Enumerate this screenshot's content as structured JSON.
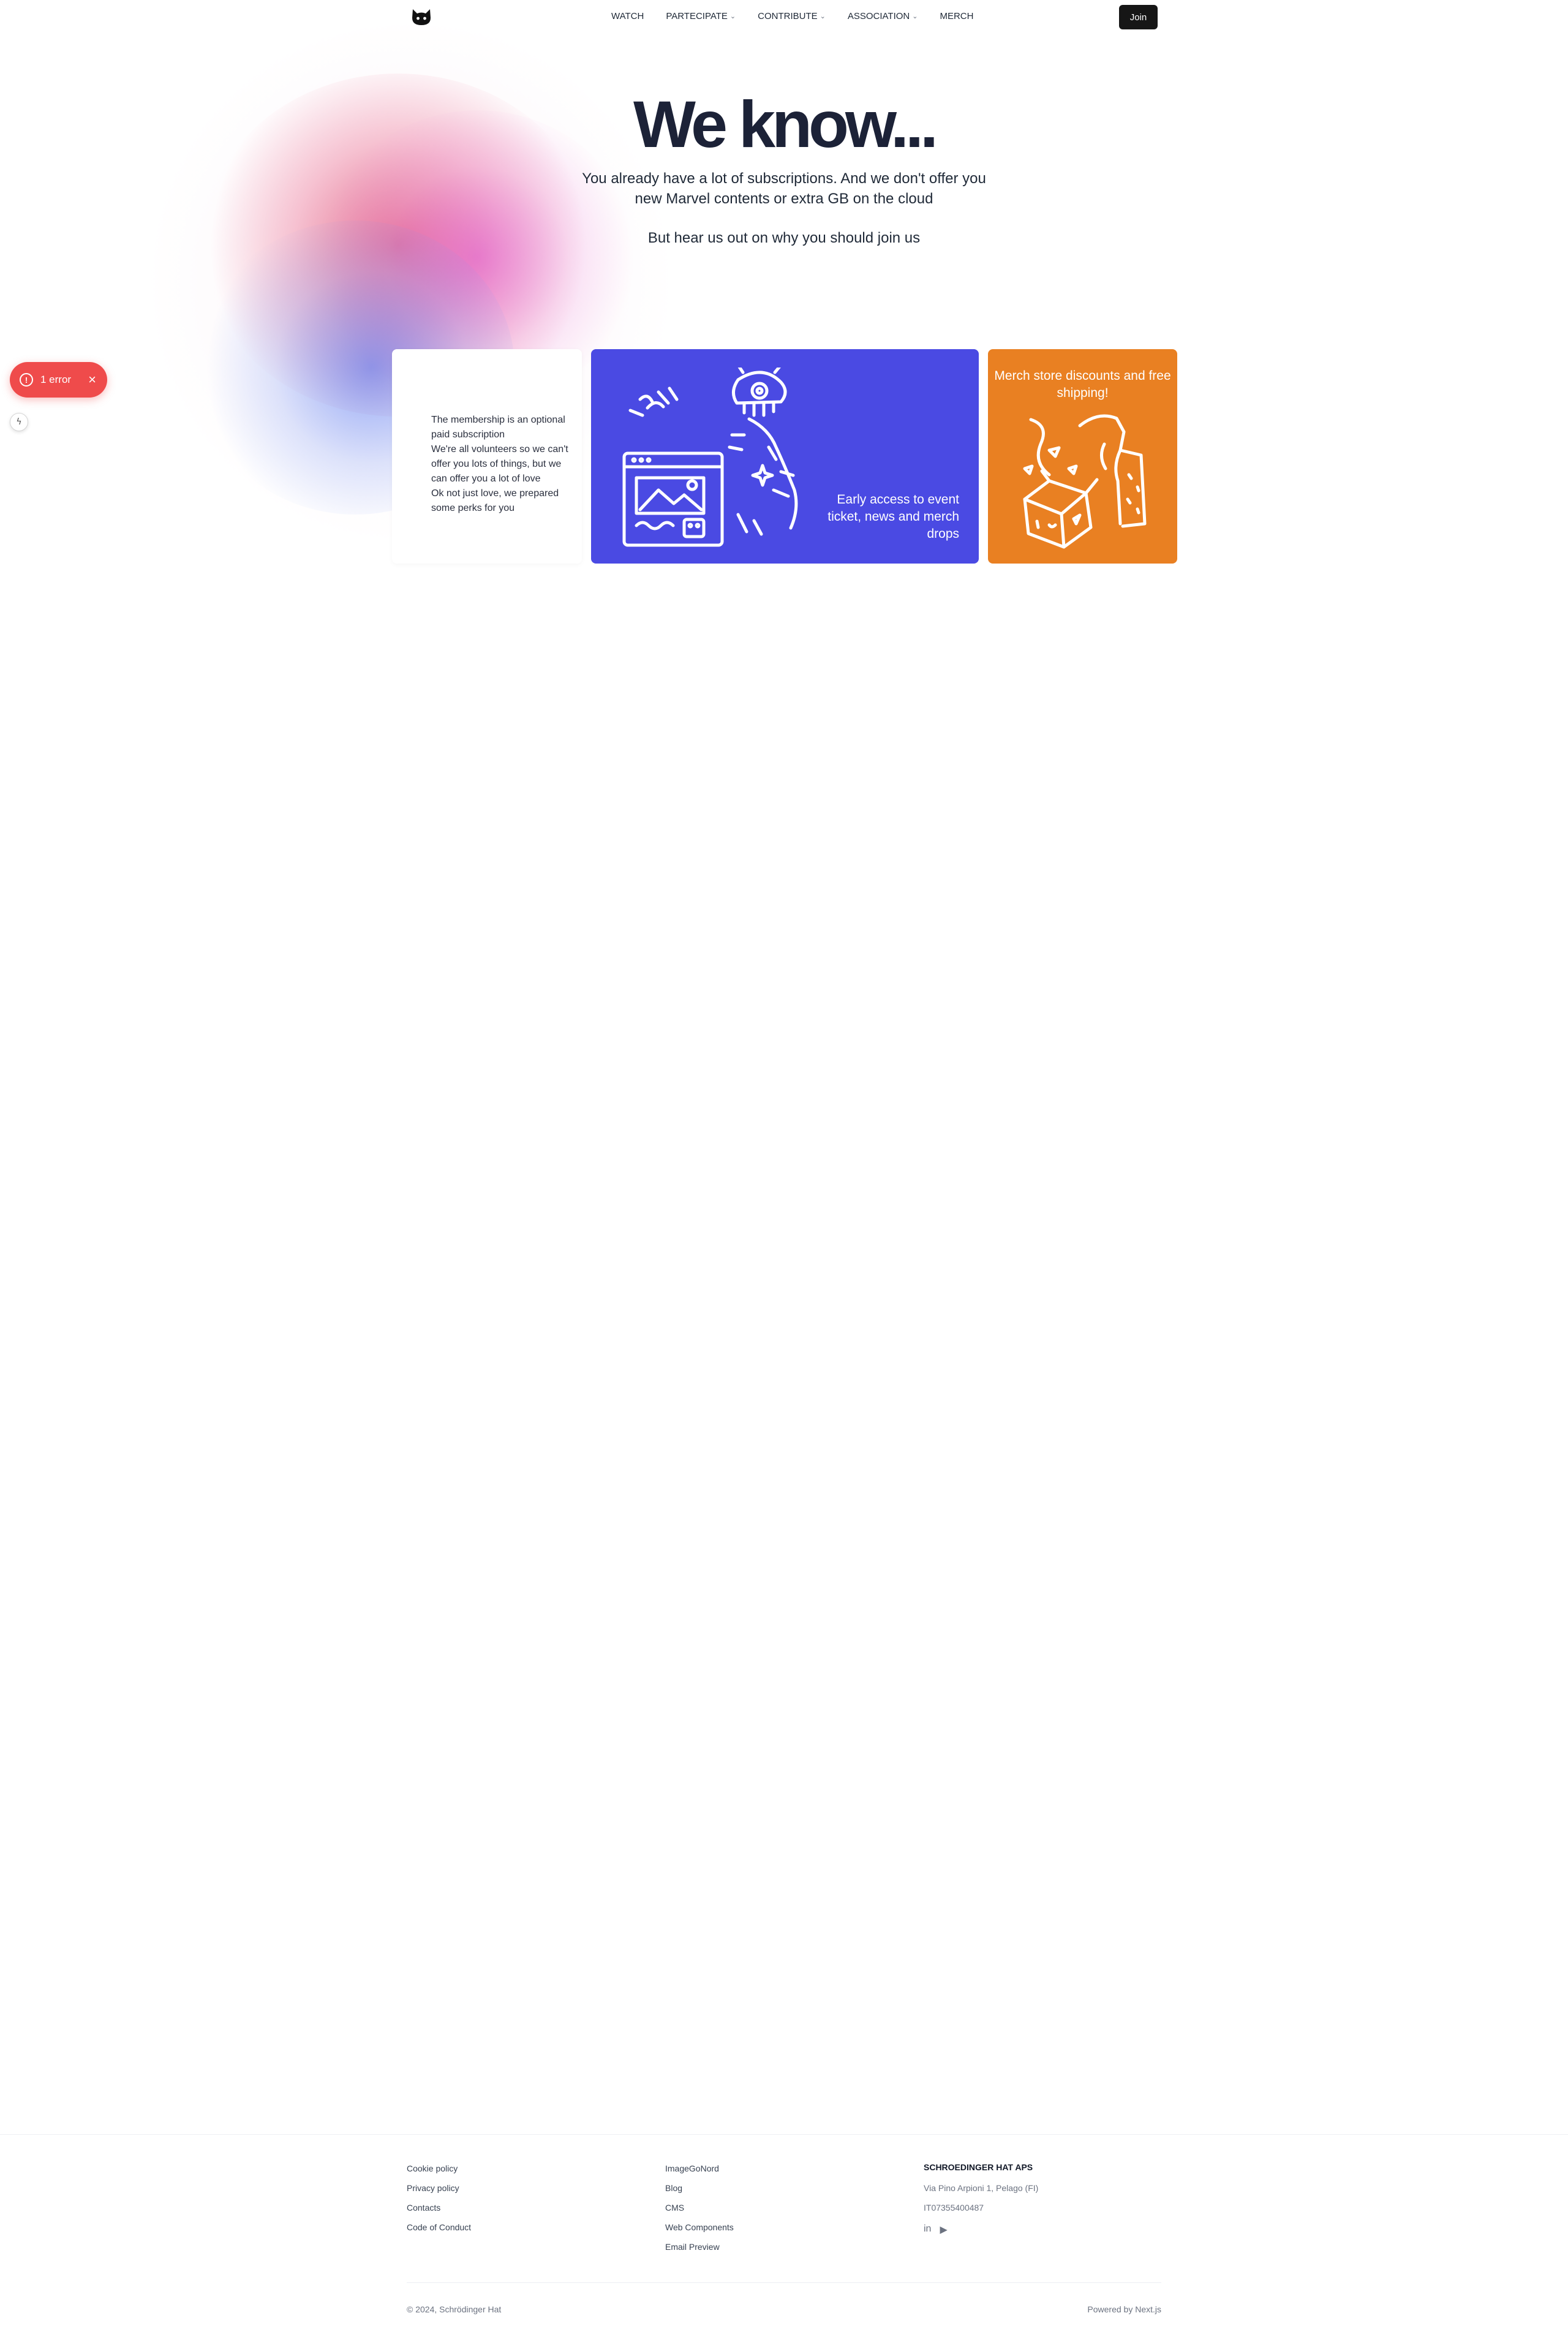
{
  "nav": {
    "items": [
      {
        "label": "WATCH",
        "dropdown": false
      },
      {
        "label": "PARTECIPATE",
        "dropdown": true
      },
      {
        "label": "CONTRIBUTE",
        "dropdown": true
      },
      {
        "label": "ASSOCIATION",
        "dropdown": true
      },
      {
        "label": "MERCH",
        "dropdown": false
      }
    ],
    "join_label": "Join",
    "logo_icon": "cat-logo-icon"
  },
  "hero": {
    "title": "We know...",
    "subtitle": "You already have a lot of subscriptions. And we don't offer you new Marvel contents or extra GB on the cloud",
    "cta": "But hear us out on why you should join us"
  },
  "error_toast": {
    "label": "1 error",
    "icon": "alert-circle-icon",
    "close_icon": "close-icon"
  },
  "cards": {
    "white": {
      "lines": [
        "The membership is an optional paid subscription",
        "We're all volunteers so we can't offer you lots of things, but we can offer you a lot of love",
        "Ok not just love, we prepared some perks for you"
      ]
    },
    "blue": {
      "text": "Early access to event ticket, news and merch drops",
      "color": "#4a4ae3"
    },
    "orange": {
      "text": "Merch store discounts and free shipping!",
      "color": "#e98022"
    }
  },
  "footer": {
    "col1": [
      "Cookie policy",
      "Privacy policy",
      "Contacts",
      "Code of Conduct"
    ],
    "col2": [
      "ImageGoNord",
      "Blog",
      "CMS",
      "Web Components",
      "Email Preview"
    ],
    "company": {
      "name": "SCHROEDINGER HAT APS",
      "address": "Via Pino Arpioni 1, Pelago (FI)",
      "vat": "IT07355400487",
      "socials": [
        "linkedin-icon",
        "youtube-icon"
      ]
    },
    "copyright": "© 2024, Schrödinger Hat",
    "powered_by": "Powered by Next.js"
  }
}
